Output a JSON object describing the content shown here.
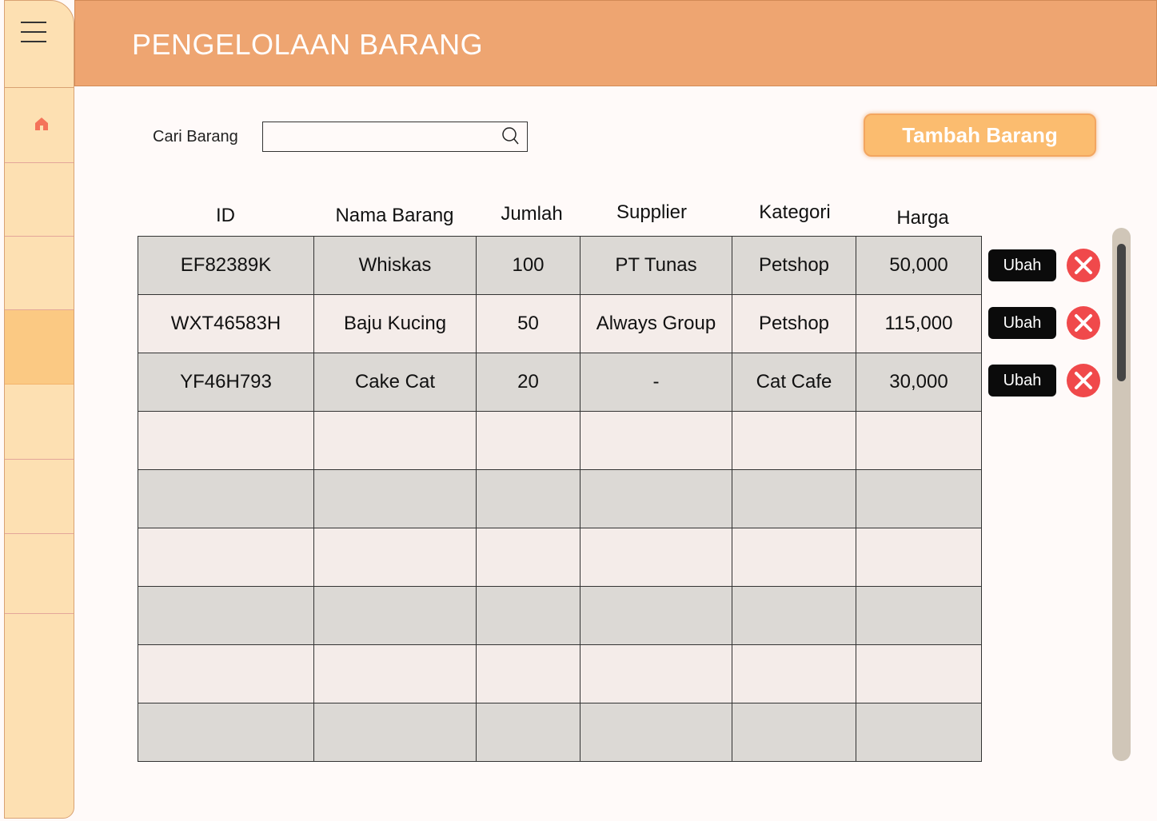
{
  "header": {
    "title": "PENGELOLAAN BARANG"
  },
  "sidebar": {
    "active_index": 3
  },
  "search": {
    "label": "Cari Barang",
    "value": "",
    "placeholder": ""
  },
  "actions": {
    "add_label": "Tambah Barang"
  },
  "table": {
    "columns": [
      "ID",
      "Nama Barang",
      "Jumlah",
      "Supplier",
      "Kategori",
      "Harga"
    ],
    "rows": [
      [
        "EF82389K",
        "Whiskas",
        "100",
        "PT Tunas",
        "Petshop",
        "50,000"
      ],
      [
        "WXT46583H",
        "Baju Kucing",
        "50",
        "Always Group",
        "Petshop",
        "115,000"
      ],
      [
        "YF46H793",
        "Cake Cat",
        "20",
        "-",
        "Cat Cafe",
        "30,000"
      ],
      [
        "",
        "",
        "",
        "",
        "",
        ""
      ],
      [
        "",
        "",
        "",
        "",
        "",
        ""
      ],
      [
        "",
        "",
        "",
        "",
        "",
        ""
      ],
      [
        "",
        "",
        "",
        "",
        "",
        ""
      ],
      [
        "",
        "",
        "",
        "",
        "",
        ""
      ],
      [
        "",
        "",
        "",
        "",
        "",
        ""
      ]
    ],
    "edit_label": "Ubah"
  },
  "colors": {
    "header": "#eea571",
    "sidebar": "#fde0b2",
    "accent_button": "#fbbc6f",
    "delete": "#f0494b"
  }
}
